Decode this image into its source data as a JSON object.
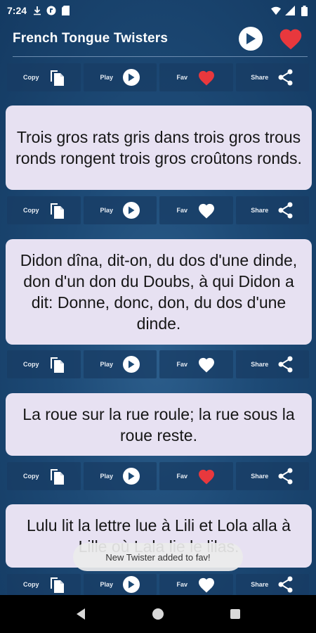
{
  "status_bar": {
    "time": "7:24",
    "icons_left": [
      "download-icon",
      "app-icon",
      "sd-card-icon"
    ],
    "icons_right": [
      "wifi-icon",
      "signal-icon",
      "battery-icon"
    ]
  },
  "app_bar": {
    "title": "French Tongue Twisters",
    "play_all_icon": "play-icon",
    "favorites_icon": "heart-icon"
  },
  "actions": {
    "copy_label": "Copy",
    "play_label": "Play",
    "fav_label": "Fav",
    "share_label": "Share"
  },
  "twisters": [
    {
      "text": "Trois gros rats gris dans trois gros trous ronds rongent trois gros croûtons ronds.",
      "fav": false
    },
    {
      "text": "Didon dîna, dit-on, du dos d'une dinde, don d'un don du Doubs, à qui Didon a dit: Donne, donc, don, du dos d'une dinde.",
      "fav": false
    },
    {
      "text": "La roue sur la rue roule; la rue sous la roue reste.",
      "fav": true
    },
    {
      "text": "Lulu lit la lettre lue à Lili et Lola alla à Lille où Lala lie le lilas.",
      "fav": false
    }
  ],
  "header_row_fav": true,
  "toast": {
    "message": "New Twister added to fav!"
  },
  "colors": {
    "background": "#1d4a76",
    "card": "#e7e1f2",
    "heart_active": "#e8383d",
    "heart_inactive": "#ffffff"
  }
}
